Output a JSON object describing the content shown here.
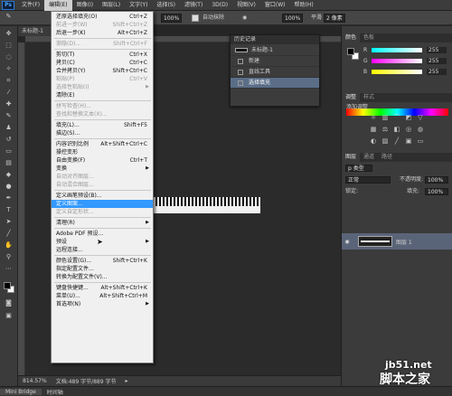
{
  "app": {
    "logo": "Ps"
  },
  "menubar": {
    "items": [
      "文件(F)",
      "编辑(E)",
      "图像(I)",
      "图层(L)",
      "文字(Y)",
      "选择(S)",
      "滤镜(T)",
      "3D(D)",
      "视图(V)",
      "窗口(W)",
      "帮助(H)"
    ],
    "active_index": 1
  },
  "options": {
    "zoom": "100%",
    "flow": "100%",
    "smooth": "平滑",
    "smooth_value": "2 像素",
    "smooth_label": "自动抹除"
  },
  "document": {
    "tab_title": "未标题-1",
    "status_zoom": "814.57%",
    "status_doc": "文档:489 字节/889 字节"
  },
  "bottom_tabs": [
    "Mini Bridge",
    "时间轴"
  ],
  "edit_menu": {
    "items": [
      {
        "label": "还原选择填充(O)",
        "shortcut": "Ctrl+Z",
        "enabled": true
      },
      {
        "label": "前进一步(W)",
        "shortcut": "Shift+Ctrl+Z",
        "enabled": false
      },
      {
        "label": "后退一步(K)",
        "shortcut": "Alt+Ctrl+Z",
        "enabled": true
      },
      {
        "sep": true
      },
      {
        "label": "渐隐(D)...",
        "shortcut": "Shift+Ctrl+F",
        "enabled": false
      },
      {
        "sep": true
      },
      {
        "label": "剪切(T)",
        "shortcut": "Ctrl+X",
        "enabled": true
      },
      {
        "label": "拷贝(C)",
        "shortcut": "Ctrl+C",
        "enabled": true
      },
      {
        "label": "合并拷贝(Y)",
        "shortcut": "Shift+Ctrl+C",
        "enabled": true
      },
      {
        "label": "粘贴(P)",
        "shortcut": "Ctrl+V",
        "enabled": false
      },
      {
        "label": "选择性粘贴(I)",
        "shortcut": "",
        "enabled": false,
        "submenu": true
      },
      {
        "label": "清除(E)",
        "shortcut": "",
        "enabled": true
      },
      {
        "sep": true
      },
      {
        "label": "拼写检查(H)...",
        "shortcut": "",
        "enabled": false
      },
      {
        "label": "查找和替换文本(X)...",
        "shortcut": "",
        "enabled": false
      },
      {
        "sep": true
      },
      {
        "label": "填充(L)...",
        "shortcut": "Shift+F5",
        "enabled": true
      },
      {
        "label": "描边(S)...",
        "shortcut": "",
        "enabled": true
      },
      {
        "sep": true
      },
      {
        "label": "内容识别比例",
        "shortcut": "Alt+Shift+Ctrl+C",
        "enabled": true
      },
      {
        "label": "操控变形",
        "shortcut": "",
        "enabled": true
      },
      {
        "label": "自由变换(F)",
        "shortcut": "Ctrl+T",
        "enabled": true
      },
      {
        "label": "变换",
        "shortcut": "",
        "enabled": true,
        "submenu": true
      },
      {
        "label": "自动对齐图层...",
        "shortcut": "",
        "enabled": false
      },
      {
        "label": "自动混合图层...",
        "shortcut": "",
        "enabled": false
      },
      {
        "sep": true
      },
      {
        "label": "定义画笔预设(B)...",
        "shortcut": "",
        "enabled": true
      },
      {
        "label": "定义图案...",
        "shortcut": "",
        "enabled": true,
        "highlight": true
      },
      {
        "label": "定义自定形状...",
        "shortcut": "",
        "enabled": false
      },
      {
        "sep": true
      },
      {
        "label": "清理(R)",
        "shortcut": "",
        "enabled": true,
        "submenu": true
      },
      {
        "sep": true
      },
      {
        "label": "Adobe PDF 预设...",
        "shortcut": "",
        "enabled": true
      },
      {
        "label": "预设",
        "shortcut": "",
        "enabled": true,
        "submenu": true
      },
      {
        "label": "远程连接...",
        "shortcut": "",
        "enabled": true
      },
      {
        "sep": true
      },
      {
        "label": "颜色设置(G)...",
        "shortcut": "Shift+Ctrl+K",
        "enabled": true
      },
      {
        "label": "指定配置文件...",
        "shortcut": "",
        "enabled": true
      },
      {
        "label": "转换为配置文件(V)...",
        "shortcut": "",
        "enabled": true
      },
      {
        "sep": true
      },
      {
        "label": "键盘快捷键...",
        "shortcut": "Alt+Shift+Ctrl+K",
        "enabled": true
      },
      {
        "label": "菜单(U)...",
        "shortcut": "Alt+Shift+Ctrl+M",
        "enabled": true
      },
      {
        "label": "首选项(N)",
        "shortcut": "",
        "enabled": true,
        "submenu": true
      }
    ]
  },
  "history": {
    "title": "历史记录",
    "snapshot": "未标题-1",
    "items": [
      {
        "label": "新建",
        "selected": false
      },
      {
        "label": "直线工具",
        "selected": false
      },
      {
        "label": "选择填充",
        "selected": true
      }
    ]
  },
  "color_panel": {
    "tabs": [
      "颜色",
      "色板"
    ],
    "sliders": [
      {
        "label": "R",
        "value": "255",
        "color": "#ff0000"
      },
      {
        "label": "G",
        "value": "255",
        "color": "#00ff00"
      },
      {
        "label": "B",
        "value": "255",
        "color": "#0000ff"
      }
    ]
  },
  "adjust_panel": {
    "tabs": [
      "调整",
      "样式"
    ],
    "title": "添加调整"
  },
  "layers_panel": {
    "tabs": [
      "图层",
      "通道",
      "路径"
    ],
    "kind": "p 类型",
    "blend_mode": "正常",
    "opacity_label": "不透明度:",
    "opacity": "100%",
    "lock_label": "锁定:",
    "fill_label": "填充:",
    "fill": "100%",
    "layer_name": "图层 1"
  },
  "watermark": {
    "line1": "jb51.net",
    "line2": "脚本之家"
  }
}
